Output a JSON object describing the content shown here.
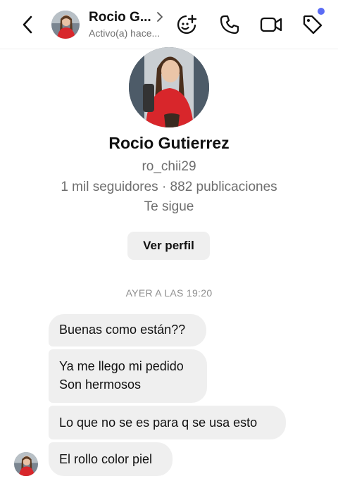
{
  "header": {
    "contact_name": "Rocio G...",
    "status": "Activo(a) hace...",
    "icons": [
      "back-chevron-icon",
      "sticker-icon",
      "phone-icon",
      "video-icon",
      "tag-icon"
    ],
    "notification_dot_color": "#5b6cf5"
  },
  "profile": {
    "full_name": "Rocio Gutierrez",
    "username": "ro_chii29",
    "stats": "1 mil seguidores · 882 publicaciones",
    "follows_you": "Te sigue",
    "view_profile_label": "Ver perfil"
  },
  "conversation": {
    "timestamp": "AYER A LAS 19:20",
    "messages": [
      {
        "lines": [
          "Buenas como están??"
        ]
      },
      {
        "lines": [
          "Ya me llego mi pedido",
          "Son hermosos"
        ]
      },
      {
        "lines": [
          "Lo que no se es para q se usa esto"
        ]
      },
      {
        "lines": [
          "El rollo color piel"
        ]
      }
    ]
  },
  "colors": {
    "bubble_bg": "#efefef",
    "secondary_text": "#6e6e6e",
    "accent_red": "#d8262b"
  }
}
